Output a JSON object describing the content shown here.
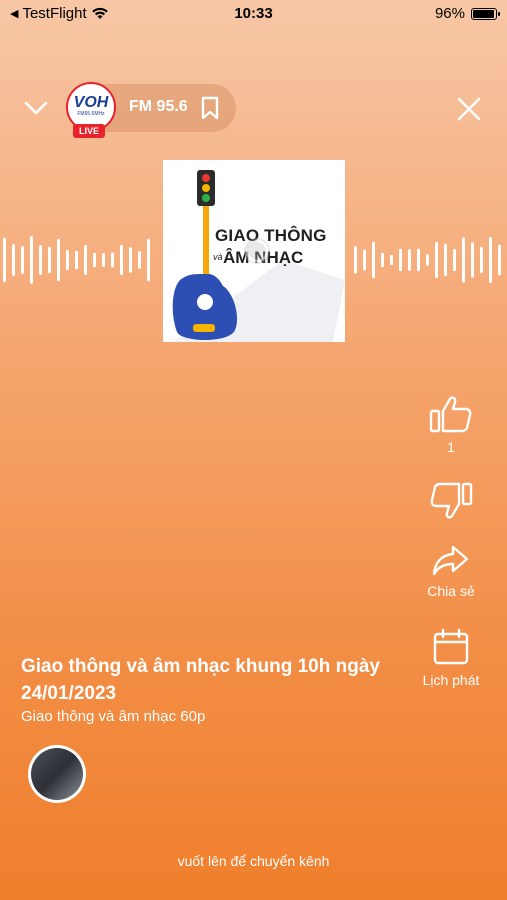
{
  "status_bar": {
    "back_app": "TestFlight",
    "time": "10:33",
    "battery": "96%",
    "battery_level": 0.96
  },
  "header": {
    "channel_logo_text": "VOH",
    "channel_logo_subtext": "FM95.6MHz",
    "live_label": "LIVE",
    "frequency": "FM 95.6",
    "icons": [
      "chevron-down-icon",
      "bookmark-icon",
      "close-icon"
    ]
  },
  "cover": {
    "title_line1": "GIAO THÔNG",
    "title_line2": "ÂM NHẠC",
    "title_connector": "và"
  },
  "actions": {
    "like_count": "1",
    "share_label": "Chia sẻ",
    "schedule_label": "Lịch phát"
  },
  "program": {
    "title": "Giao thông và âm nhạc khung 10h ngày 24/01/2023",
    "subtitle": "Giao thông và âm nhạc 60p"
  },
  "hint": "vuốt lên để chuyển kênh",
  "colors": {
    "gradient_top": "#f7c7a6",
    "gradient_bottom": "#ef7f2c",
    "logo_red": "#e8232c",
    "logo_blue": "#1b3e95"
  }
}
